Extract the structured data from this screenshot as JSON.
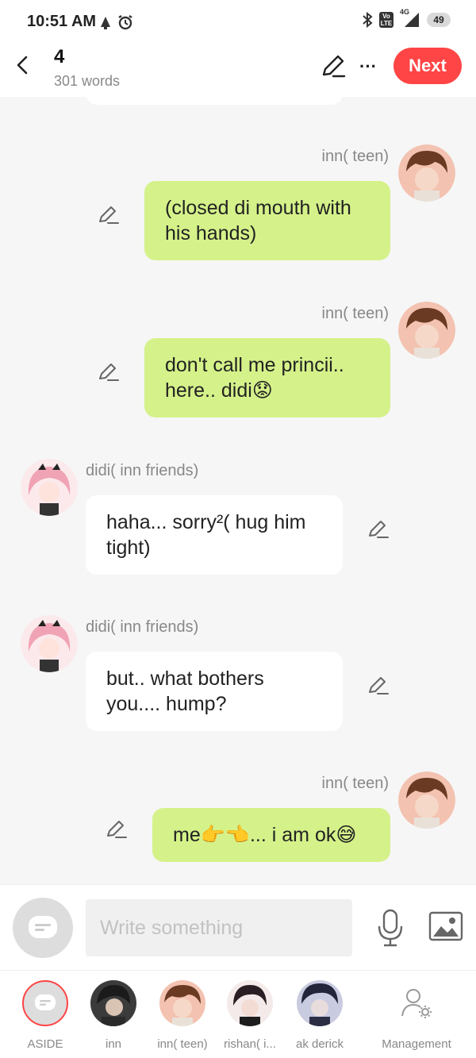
{
  "status_bar": {
    "time": "10:51 AM",
    "network": "4G",
    "volte": "Vo LTE",
    "battery": "49"
  },
  "header": {
    "chapter": "4",
    "word_count": "301 words",
    "next_label": "Next",
    "more_label": "···"
  },
  "messages": [
    {
      "side": "right",
      "name": "inn( teen)",
      "text_line1": "(closed di mouth with",
      "text_line2": "his hands)"
    },
    {
      "side": "right",
      "name": "inn( teen)",
      "text_line1": "don't call me princii..",
      "text_line2": "here.. didi😟"
    },
    {
      "side": "left",
      "name": "didi( inn friends)",
      "text_line1": "haha... sorry²( hug him",
      "text_line2": "tight)"
    },
    {
      "side": "left",
      "name": "didi( inn friends)",
      "text_line1": "but.. what bothers",
      "text_line2": "you.... hump?"
    },
    {
      "side": "right",
      "name": "inn( teen)",
      "text_line1": "me👉👈... i am ok😅"
    }
  ],
  "composer": {
    "placeholder": "Write something"
  },
  "characters": [
    {
      "label": "ASIDE",
      "selected": true
    },
    {
      "label": "inn"
    },
    {
      "label": "inn( teen)"
    },
    {
      "label": "rishan( i..."
    },
    {
      "label": "ak derick"
    },
    {
      "label": "Management"
    }
  ],
  "colors": {
    "accent": "#ff4545",
    "right_bubble": "#d5f28a",
    "left_bubble": "#ffffff"
  }
}
